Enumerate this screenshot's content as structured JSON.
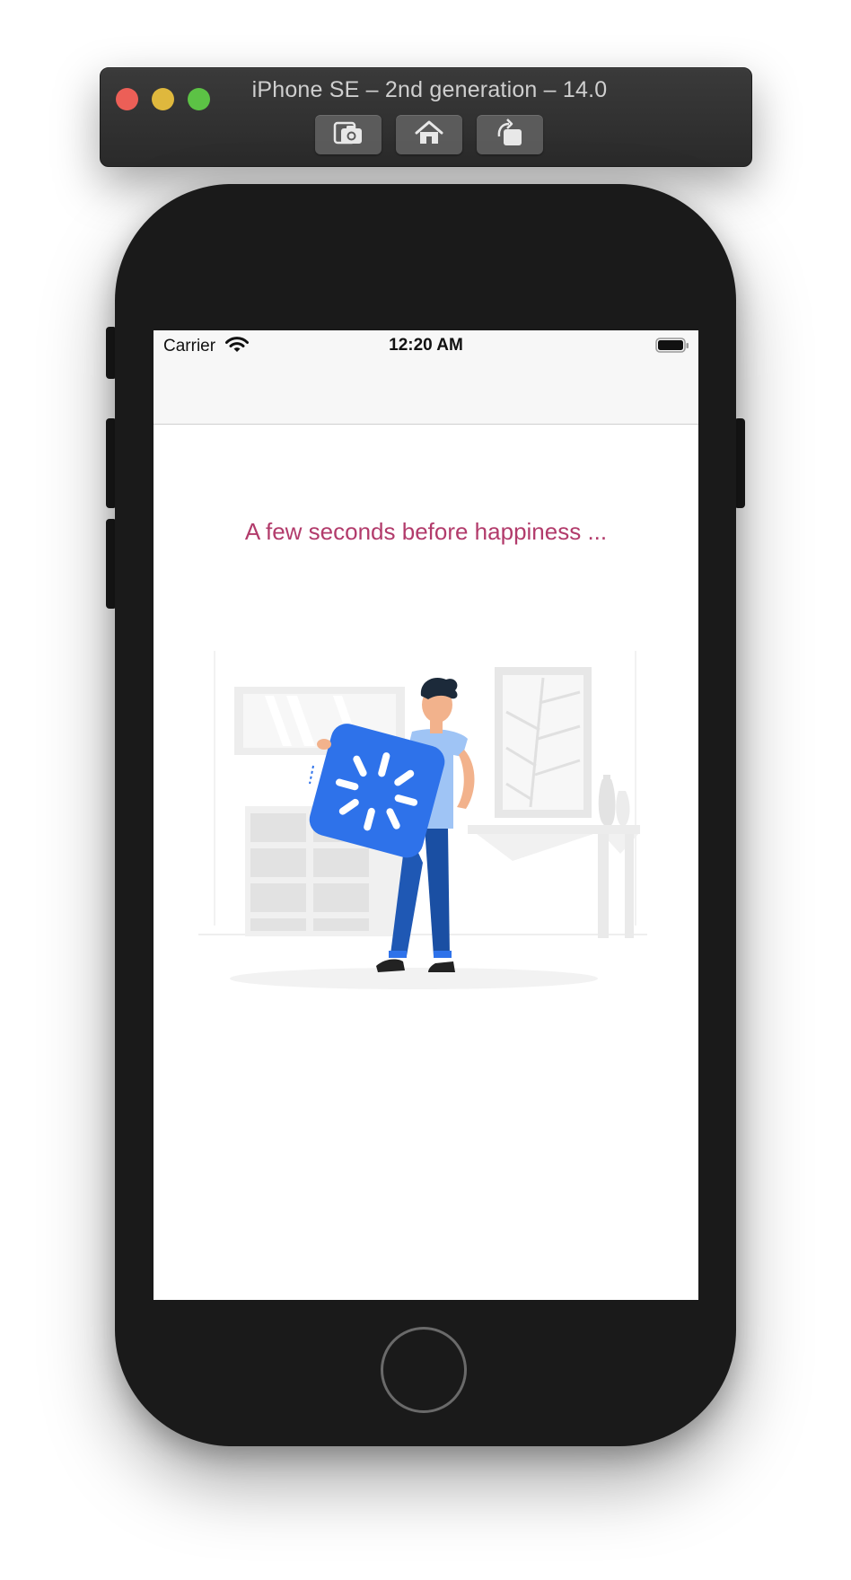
{
  "simulator": {
    "title": "iPhone SE – 2nd generation – 14.0",
    "buttons": [
      "screenshot-icon",
      "home-icon",
      "rotate-icon"
    ]
  },
  "status_bar": {
    "carrier": "Carrier",
    "time": "12:20 AM"
  },
  "content": {
    "message": "A few seconds before happiness ..."
  },
  "colors": {
    "message": "#b23b6b",
    "box": "#2e72ea",
    "pants": "#1f58b4",
    "shirt": "#9fc4f5"
  }
}
